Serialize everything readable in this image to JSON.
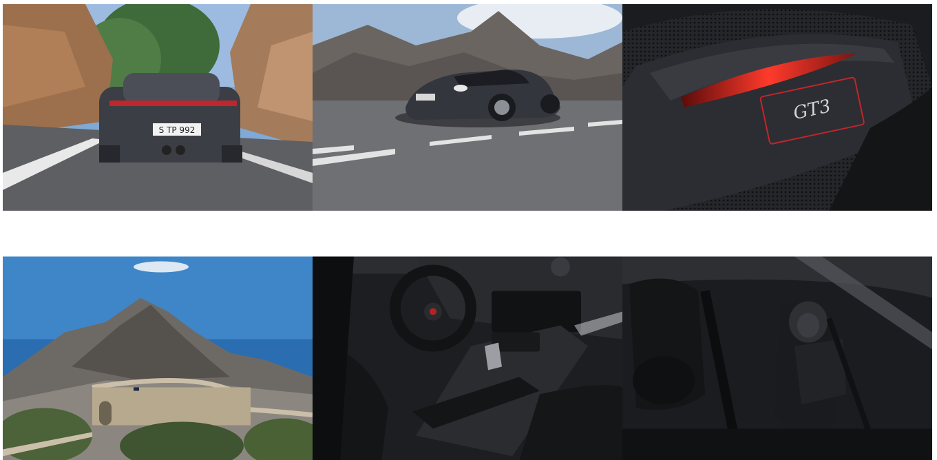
{
  "gallery": {
    "items": [
      {
        "name": "rear-view-mountain-road-photo",
        "plate": "S TP 992"
      },
      {
        "name": "front-three-quarter-road-photo",
        "plate": ""
      },
      {
        "name": "gt3-badge-detail-photo",
        "badge": "GT3"
      },
      {
        "name": "coastal-mountain-road-photo"
      },
      {
        "name": "interior-cockpit-photo"
      },
      {
        "name": "bucket-seats-interior-photo"
      }
    ]
  },
  "colors": {
    "sky": "#6f9fd6",
    "rock": "#8a6a4f",
    "road": "#5c5e62",
    "car": "#3b3d44",
    "accent_red": "#e0281f",
    "interior": "#1c1e22"
  }
}
